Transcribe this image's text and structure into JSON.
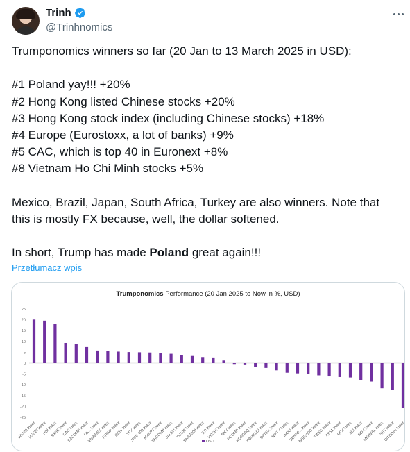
{
  "author": {
    "name": "Trinh",
    "handle": "@Trinhnomics"
  },
  "tweet": {
    "lines": [
      "Trumponomics winners so far (20 Jan to 13 March 2025 in USD):",
      "",
      "#1 Poland yay!!! +20%",
      "#2 Hong Kong listed Chinese stocks +20%",
      "#3 Hong Kong stock index (including Chinese stocks) +18%",
      "#4 Europe (Eurostoxx, a lot of banks) +9%",
      "#5 CAC, which is top 40 in Euronext +8%",
      "#8 Vietnam Ho Chi Minh stocks +5%",
      "",
      "Mexico, Brazil, Japan, South Africa, Turkey are also winners. Note that",
      "this is mostly FX because, well, the dollar softened.",
      ""
    ],
    "last_line_prefix": "In short, Trump has made ",
    "last_line_bold": "Poland",
    "last_line_suffix": " great again!!!",
    "translate_label": "Przetłumacz wpis"
  },
  "chart_data": {
    "type": "bar",
    "title_bold": "Trumponomics",
    "title_rest": " Performance  (20 Jan 2025 to Now in %, USD)",
    "legend": "USD",
    "ylim": [
      -25,
      25
    ],
    "yticks": [
      25,
      20,
      15,
      10,
      5,
      0,
      -5,
      -10,
      -15,
      -20,
      -25
    ],
    "bar_color": "#7030a0",
    "categories": [
      "WIG20 Index",
      "HSCEI Index",
      "HSI Index",
      "SX5E Index",
      "CAC Index",
      "SZCOMP Index",
      "UKX Index",
      "VNINDEX Index",
      "FTBVA Index",
      "IBOV Index",
      "TPX Index",
      "JPNK400 Index",
      "MXAPJ Index",
      "SHCOMP Index",
      "JALSH Index",
      "XU100 Index",
      "SHSZ300 Index",
      "STI Index",
      "KOSPI Index",
      "NKY Index",
      "PCOMP Index",
      "KOSDAQ Index",
      "FBMKLCI Index",
      "SPTSX Index",
      "NIFTY Index",
      "INDU Index",
      "SENSEX Index",
      "NSE500G Index",
      "TWSE Index",
      "AS51 Index",
      "SPX Index",
      "JCI Index",
      "NDX Index",
      "MERVAL Index",
      "SET Index",
      "BITCOIN Index"
    ],
    "values": [
      20.1,
      19.6,
      18.0,
      9.3,
      8.8,
      7.4,
      5.8,
      5.5,
      5.3,
      5.1,
      5.0,
      4.9,
      4.6,
      4.3,
      3.7,
      3.3,
      2.8,
      2.6,
      1.2,
      -0.4,
      -0.6,
      -1.6,
      -2.2,
      -3.3,
      -4.4,
      -4.7,
      -4.9,
      -5.6,
      -6.1,
      -6.4,
      -6.6,
      -7.7,
      -8.5,
      -11.6,
      -12.2,
      -20.7
    ]
  }
}
